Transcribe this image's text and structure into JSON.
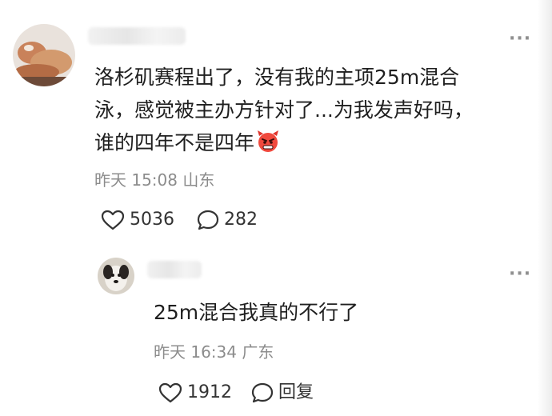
{
  "comment": {
    "text_line1": "洛杉矶赛程出了，没有我的主项25m混合",
    "text_line2": "泳，感觉被主办方针对了...为我发声好吗，",
    "text_line3": "谁的四年不是四年",
    "emoji": "devil-emoji",
    "meta": "昨天 15:08 山东",
    "likes": "5036",
    "replies": "282",
    "more": "···"
  },
  "reply": {
    "text": "25m混合我真的不行了",
    "meta": "昨天 16:34 广东",
    "likes": "1912",
    "reply_label": "回复",
    "more": "···"
  },
  "icons": [
    "heart-icon",
    "speech-bubble-icon",
    "more-icon"
  ]
}
